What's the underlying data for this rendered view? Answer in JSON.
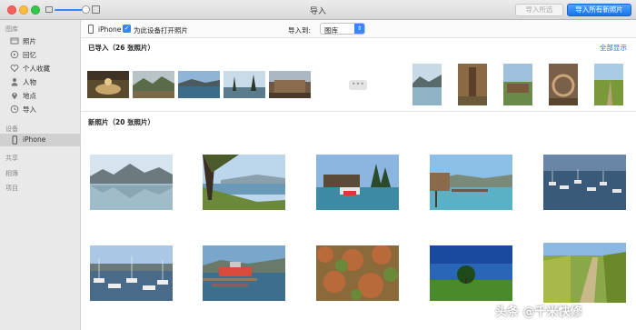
{
  "window": {
    "title": "导入"
  },
  "toolbar": {
    "import_selected_label": "导入所选",
    "import_all_label": "导入所有新照片"
  },
  "sidebar": {
    "library_header": "图库",
    "library_items": [
      {
        "label": "照片",
        "icon": "photos-icon"
      },
      {
        "label": "回忆",
        "icon": "memories-icon"
      },
      {
        "label": "个人收藏",
        "icon": "heart-icon"
      },
      {
        "label": "人物",
        "icon": "person-icon"
      },
      {
        "label": "地点",
        "icon": "location-pin-icon"
      },
      {
        "label": "导入",
        "icon": "import-clock-icon"
      }
    ],
    "devices_header": "设备",
    "device_item": {
      "label": "iPhone",
      "icon": "iphone-icon"
    },
    "shared_header": "共享",
    "albums_header": "相簿",
    "projects_header": "项目"
  },
  "device_bar": {
    "device_name": "iPhone",
    "open_photos_label": "为此设备打开照片",
    "open_photos_checked": true,
    "import_to_label": "导入到:",
    "import_to_value": "图库"
  },
  "imported": {
    "title": "已导入（26 张照片）",
    "show_all_label": "全部显示"
  },
  "new_photos": {
    "title": "新照片（20 张照片）"
  },
  "watermark": {
    "text": "头条 @千米快修"
  },
  "colors": {
    "accent": "#1a74e9",
    "sidebar_bg": "#e9e9e9",
    "selected_bg": "#d0d0d0"
  }
}
